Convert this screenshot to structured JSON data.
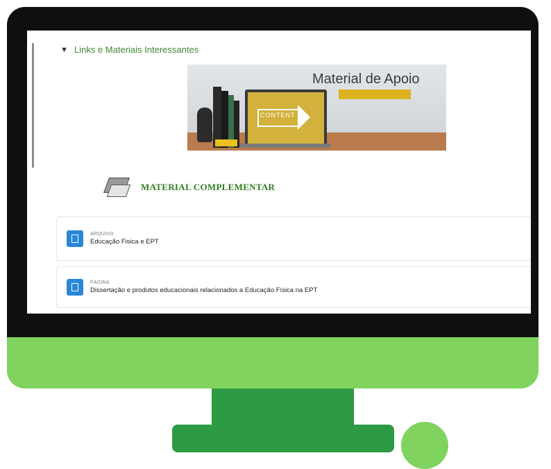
{
  "section": {
    "title": "Links e Materiais Interessantes"
  },
  "banner": {
    "title": "Material de Apoio",
    "content_label": "CONTENT"
  },
  "complementar": {
    "label": "MATERIAL COMPLEMENTAR"
  },
  "activities": [
    {
      "type": "ARQUIVO",
      "name": "Educação Fisica e EPT",
      "icon": "file-icon"
    },
    {
      "type": "PÁGINA",
      "name": "Dissertação e produtos educacionais relacionados a Educação Física na EPT",
      "icon": "page-icon"
    }
  ],
  "colors": {
    "accent_green": "#3b8a2f",
    "bezel_green": "#7fd35e",
    "stand_green": "#2d9a44",
    "icon_blue": "#2a86d6"
  }
}
